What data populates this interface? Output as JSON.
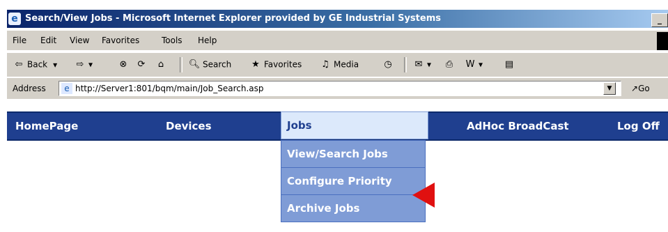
{
  "window": {
    "title": "Search/View Jobs - Microsoft Internet Explorer provided by GE Industrial Systems",
    "minimize_label": "_"
  },
  "menu": {
    "items": [
      "File",
      "Edit",
      "View",
      "Favorites",
      "Tools",
      "Help"
    ]
  },
  "toolbar": {
    "back_label": "Back",
    "search_label": "Search",
    "favorites_label": "Favorites",
    "media_label": "Media"
  },
  "address": {
    "label": "Address",
    "url": "http://Server1:801/bqm/main/Job_Search.asp",
    "go_label": "Go"
  },
  "nav": {
    "items": [
      "HomePage",
      "Devices",
      "Jobs",
      "AdHoc BroadCast",
      "Log Off"
    ],
    "active_index": 2
  },
  "jobs_submenu": {
    "items": [
      "View/Search Jobs",
      "Configure Priority",
      "Archive Jobs"
    ],
    "highlighted_index": 1
  },
  "colors": {
    "nav_background": "#1f3f8f",
    "active_tab_background": "#dce9fb",
    "submenu_background": "#7f9cd6",
    "arrow": "#e01010"
  }
}
